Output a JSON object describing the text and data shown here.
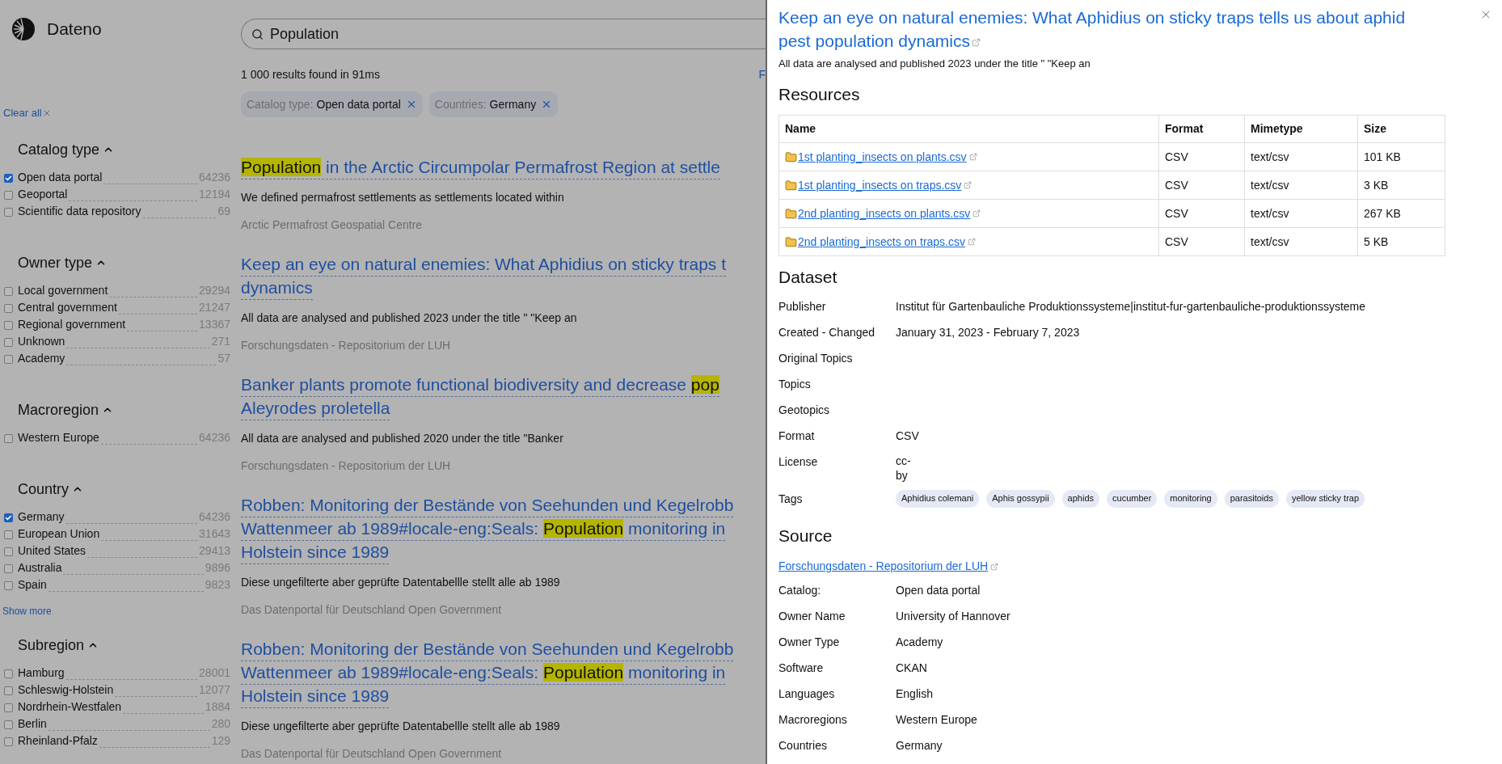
{
  "app": {
    "name": "Dateno"
  },
  "search": {
    "value": "Population"
  },
  "results_summary": "1 000 results found in 91ms",
  "cut_link": "F",
  "clear_all": "Clear all",
  "facets": [
    {
      "title": "Catalog type",
      "expanded": true,
      "items": [
        {
          "label": "Open data portal",
          "count": "64236",
          "checked": true
        },
        {
          "label": "Geoportal",
          "count": "12194",
          "checked": false
        },
        {
          "label": "Scientific data repository",
          "count": "69",
          "checked": false
        }
      ]
    },
    {
      "title": "Owner type",
      "expanded": true,
      "items": [
        {
          "label": "Local government",
          "count": "29294",
          "checked": false
        },
        {
          "label": "Central government",
          "count": "21247",
          "checked": false
        },
        {
          "label": "Regional government",
          "count": "13367",
          "checked": false
        },
        {
          "label": "Unknown",
          "count": "271",
          "checked": false
        },
        {
          "label": "Academy",
          "count": "57",
          "checked": false
        }
      ]
    },
    {
      "title": "Macroregion",
      "expanded": true,
      "items": [
        {
          "label": "Western Europe",
          "count": "64236",
          "checked": false
        }
      ]
    },
    {
      "title": "Country",
      "expanded": true,
      "show_more": "Show more",
      "items": [
        {
          "label": "Germany",
          "count": "64236",
          "checked": true
        },
        {
          "label": "European Union",
          "count": "31643",
          "checked": false
        },
        {
          "label": "United States",
          "count": "29413",
          "checked": false
        },
        {
          "label": "Australia",
          "count": "9896",
          "checked": false
        },
        {
          "label": "Spain",
          "count": "9823",
          "checked": false
        }
      ]
    },
    {
      "title": "Subregion",
      "expanded": true,
      "items": [
        {
          "label": "Hamburg",
          "count": "28001",
          "checked": false
        },
        {
          "label": "Schleswig-Holstein",
          "count": "12077",
          "checked": false
        },
        {
          "label": "Nordrhein-Westfalen",
          "count": "1884",
          "checked": false
        },
        {
          "label": "Berlin",
          "count": "280",
          "checked": false
        },
        {
          "label": "Rheinland-Pfalz",
          "count": "129",
          "checked": false
        }
      ]
    }
  ],
  "active_filters": [
    {
      "name": "Catalog type:",
      "value": "Open data portal"
    },
    {
      "name": "Countries:",
      "value": "Germany"
    }
  ],
  "results": [
    {
      "title_lines": [
        [
          {
            "text": "Population",
            "highlighted": true
          },
          {
            "text": " in the Arctic Circumpolar Permafrost Region at settle",
            "highlighted": false
          }
        ]
      ],
      "snippet": "We defined permafrost settlements as settlements located within",
      "source": "Arctic Permafrost Geospatial Centre"
    },
    {
      "title_lines": [
        [
          {
            "text": "Keep an eye on natural enemies: What Aphidius on sticky traps t",
            "highlighted": false
          }
        ],
        [
          {
            "text": "dynamics",
            "highlighted": false
          }
        ]
      ],
      "snippet": "All data are analysed and published 2023 under the title \" \"Keep an",
      "source": "Forschungsdaten - Repositorium der LUH"
    },
    {
      "title_lines": [
        [
          {
            "text": "Banker plants promote functional biodiversity and decrease ",
            "highlighted": false
          },
          {
            "text": "pop",
            "highlighted": true
          }
        ],
        [
          {
            "text": "Aleyrodes proletella",
            "highlighted": false
          }
        ]
      ],
      "snippet": "All data are analysed and published 2020 under the title \"Banker",
      "source": "Forschungsdaten - Repositorium der LUH"
    },
    {
      "title_lines": [
        [
          {
            "text": "Robben: Monitoring der Bestände von Seehunden und Kegelrobb",
            "highlighted": false
          }
        ],
        [
          {
            "text": "Wattenmeer ab 1989#locale-eng:Seals: ",
            "highlighted": false
          },
          {
            "text": "Population",
            "highlighted": true
          },
          {
            "text": " monitoring in",
            "highlighted": false
          }
        ],
        [
          {
            "text": "Holstein since 1989",
            "highlighted": false
          }
        ]
      ],
      "snippet": "Diese ungefilterte aber geprüfte Datentabellle stellt alle ab 1989",
      "source": "Das Datenportal für Deutschland Open Government"
    },
    {
      "title_lines": [
        [
          {
            "text": "Robben: Monitoring der Bestände von Seehunden und Kegelrobb",
            "highlighted": false
          }
        ],
        [
          {
            "text": "Wattenmeer ab 1989#locale-eng:Seals: ",
            "highlighted": false
          },
          {
            "text": "Population",
            "highlighted": true
          },
          {
            "text": " monitoring in",
            "highlighted": false
          }
        ],
        [
          {
            "text": "Holstein since 1989",
            "highlighted": false
          }
        ]
      ],
      "snippet": "Diese ungefilterte aber geprüfte Datentabellle stellt alle ab 1989",
      "source": "Das Datenportal für Deutschland Open Government"
    }
  ],
  "detail": {
    "title": "Keep an eye on natural enemies: What Aphidius on sticky traps tells us about aphid pest population dynamics",
    "snippet": "All data are analysed and published 2023 under the title \" \"Keep an",
    "resources": {
      "heading": "Resources",
      "columns": [
        "Name",
        "Format",
        "Mimetype",
        "Size"
      ],
      "rows": [
        {
          "name": "1st planting_insects on plants.csv",
          "format": "CSV",
          "mimetype": "text/csv",
          "size": "101 KB"
        },
        {
          "name": "1st planting_insects on traps.csv",
          "format": "CSV",
          "mimetype": "text/csv",
          "size": "3 KB"
        },
        {
          "name": "2nd planting_insects on plants.csv",
          "format": "CSV",
          "mimetype": "text/csv",
          "size": "267 KB"
        },
        {
          "name": "2nd planting_insects on traps.csv",
          "format": "CSV",
          "mimetype": "text/csv",
          "size": "5 KB"
        }
      ]
    },
    "dataset": {
      "heading": "Dataset",
      "fields": [
        {
          "kind": "text",
          "label": "Publisher",
          "value": "Institut für Gartenbauliche Produktionssysteme|institut-fur-gartenbauliche-produktionssysteme"
        },
        {
          "kind": "text",
          "label": "Created - Changed",
          "value": "January 31, 2023 - February 7, 2023"
        },
        {
          "kind": "text",
          "label": "Original Topics"
        },
        {
          "kind": "text",
          "label": "Topics"
        },
        {
          "kind": "text",
          "label": "Geotopics"
        },
        {
          "kind": "text",
          "label": "Format",
          "value": "CSV"
        },
        {
          "kind": "wrapped",
          "label": "License",
          "value": "cc-by"
        },
        {
          "kind": "tags",
          "label": "Tags",
          "tags": [
            "Aphidius colemani",
            "Aphis gossypii",
            "aphids",
            "cucumber",
            "monitoring",
            "parasitoids",
            "yellow sticky trap"
          ]
        }
      ]
    },
    "source": {
      "heading": "Source",
      "link": "Forschungsdaten - Repositorium der LUH",
      "fields": [
        {
          "label": "Catalog:",
          "value": "Open data portal"
        },
        {
          "label": "Owner Name",
          "value": "University of Hannover"
        },
        {
          "label": "Owner Type",
          "value": "Academy"
        },
        {
          "label": "Software",
          "value": "CKAN"
        },
        {
          "label": "Languages",
          "value": "English"
        },
        {
          "label": "Macroregions",
          "value": "Western Europe"
        },
        {
          "label": "Countries",
          "value": "Germany"
        }
      ]
    }
  }
}
